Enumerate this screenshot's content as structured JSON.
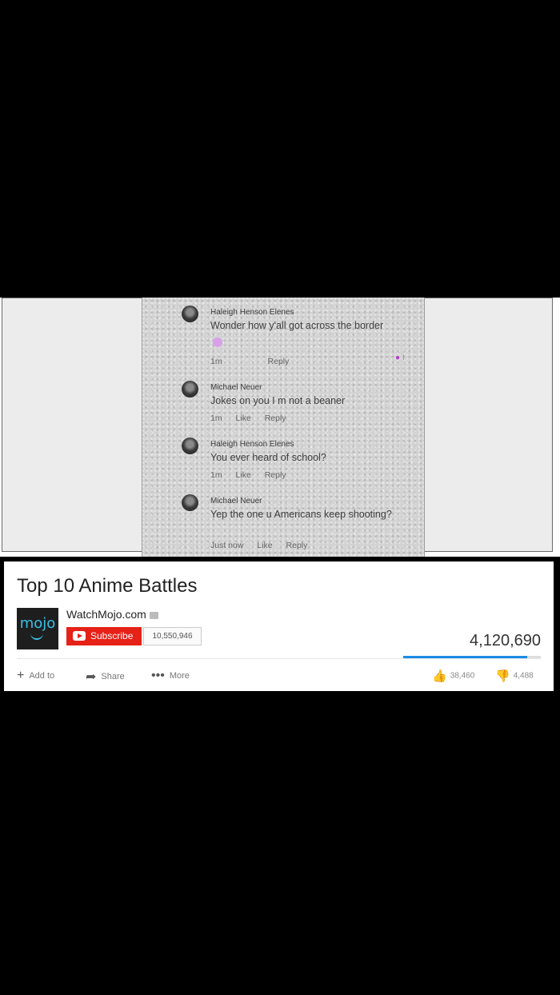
{
  "comments": [
    {
      "name": "Haleigh Henson Elenes",
      "text": "Wonder how y'all got across the border",
      "time": "1m",
      "like": "",
      "reply": "Reply"
    },
    {
      "name": "Michael Neuer",
      "text": "Jokes on you I m  not a beaner",
      "time": "1m",
      "like": "Like",
      "reply": "Reply"
    },
    {
      "name": "Haleigh Henson Elenes",
      "text": "You ever heard of school?",
      "time": "1m",
      "like": "Like",
      "reply": "Reply"
    },
    {
      "name": "Michael Neuer",
      "text": "Yep the one u Americans keep shooting?",
      "time": "Just now",
      "like": "Like",
      "reply": "Reply"
    }
  ],
  "video": {
    "title": "Top 10 Anime Battles",
    "channel": "WatchMojo.com",
    "logo_text": "mojo",
    "subscribe_label": "Subscribe",
    "subscriber_count": "10,550,946",
    "views": "4,120,690",
    "like_ratio": 0.9
  },
  "actions": {
    "add": "Add to",
    "share": "Share",
    "more": "More"
  },
  "ratings": {
    "likes": "38,460",
    "dislikes": "4,488"
  },
  "colors": {
    "subscribe": "#e62117",
    "accent": "#1d8be6",
    "logo": "#38c0e6"
  }
}
